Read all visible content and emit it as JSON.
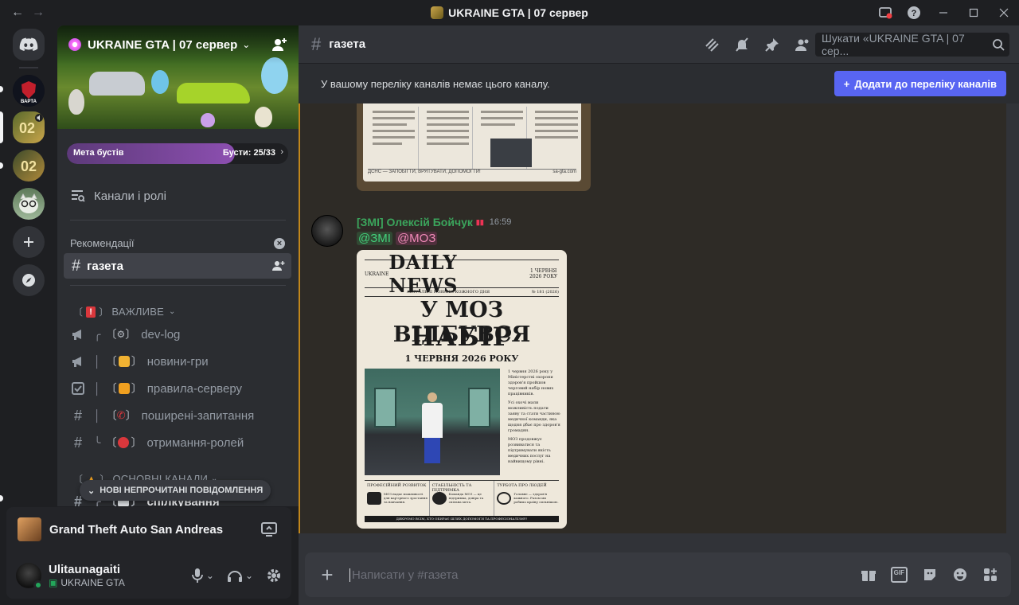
{
  "titlebar": {
    "title": "UKRAINE GTA | 07 сервер",
    "back_icon": "arrow-left-icon",
    "forward_icon": "arrow-right-icon"
  },
  "server_rail": {
    "items": [
      {
        "name": "discord-home-icon"
      },
      {
        "name": "server-varta"
      },
      {
        "name": "server-ukraine-gta-07"
      },
      {
        "name": "server-02"
      },
      {
        "name": "server-cat"
      },
      {
        "name": "add-server-icon"
      },
      {
        "name": "discover-icon"
      }
    ]
  },
  "sidebar": {
    "server_name": "UKRAINE GTA | 07 сервер",
    "boost": {
      "label": "Мета бустів",
      "count": "Бусти: 25/33",
      "progress": 0.76
    },
    "browse": "Канали і ролі",
    "recommendations": "Рекомендації",
    "active_channel": "газета",
    "categories": [
      {
        "name": "ВАЖЛИВЕ"
      },
      {
        "name": "ОСНОВНІ КАНАЛИ"
      }
    ],
    "channels": [
      {
        "name": "dev-log"
      },
      {
        "name": "новини-гри"
      },
      {
        "name": "правила-серверу"
      },
      {
        "name": "поширені-запитання"
      },
      {
        "name": "отримання-ролей"
      },
      {
        "name": "спілкування"
      }
    ],
    "new_unread": "НОВІ НЕПРОЧИТАНІ ПОВІДОМЛЕННЯ"
  },
  "activity": {
    "game": "Grand Theft Auto San Andreas"
  },
  "user": {
    "name": "Ulitaunagaiti",
    "status": "UKRAINE GTA"
  },
  "header": {
    "channel": "газета",
    "search_placeholder": "Шукати «UKRAINE GTA | 07 сер..."
  },
  "notice": {
    "text": "У вашому переліку каналів немає цього каналу.",
    "button": "Додати до переліку каналів"
  },
  "message": {
    "author": "[ЗМІ] Олексій Бойчук",
    "time": "16:59",
    "mentions": [
      "@ЗМІ",
      "@МОЗ"
    ]
  },
  "newspaper": {
    "left": "UKRAINE",
    "title": "DAILY NEWS",
    "date_small": "1 ЧЕРВНЯ 2026 РОКУ",
    "tagline": "АКТУАЛЬНІ НОВИНИ КОЖНОГО ДНЯ",
    "number": "№ 181 (2026)",
    "headline1": "У МОЗ ВІДБУВСЯ",
    "headline2": "НАБІР",
    "headline_date": "1 ЧЕРВНЯ 2026 РОКУ",
    "body": [
      "1 червня 2026 року у Міністерстві охорони здоров'я пройшов черговий набір нових працівників.",
      "Усі охочі мали можливість подати заяву та стати частиною медичної команди, яка щодня дбає про здоров'я громадян.",
      "МОЗ продовжує розвиватися та підтримувати якість медичних послуг на найвищому рівні."
    ],
    "columns": [
      {
        "title": "ПРОФЕСІЙНИЙ РОЗВИТОК",
        "text": "МОЗ надає можливості для кар'єрного зростання та навчання."
      },
      {
        "title": "СТАБІЛЬНІСТЬ ТА ПІДТРИМКА",
        "text": "Команда МОЗ — це підтримка, довіра та спільна мета."
      },
      {
        "title": "ТУРБОТА ПРО ЛЮДЕЙ",
        "text": "Головне — здоров'я кожного. Разом ми робимо країну сильнішою."
      }
    ],
    "footer": "ДЯКУЄМО ВСІМ, ХТО ОБИРАЄ ШЛЯХ ДОПОМОГИ ТА ПРОФЕСІОНАЛІЗМУ!"
  },
  "old_paper": {
    "footer_left": "ДСНС — ЗАПОБІГТИ, ВРЯТУВАТИ, ДОПОМОГТИ!",
    "footer_right": "sa-gta.com"
  },
  "composer": {
    "placeholder": "Написати у #газета"
  }
}
